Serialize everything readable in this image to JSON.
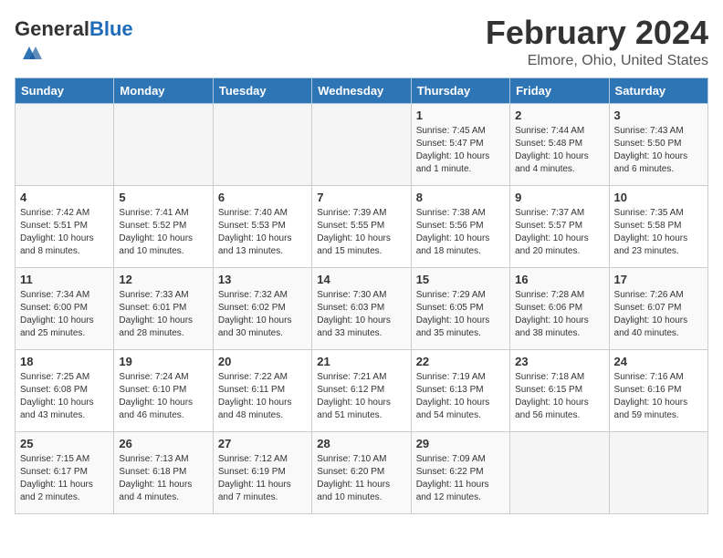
{
  "header": {
    "logo_general": "General",
    "logo_blue": "Blue",
    "month_title": "February 2024",
    "location": "Elmore, Ohio, United States"
  },
  "days_of_week": [
    "Sunday",
    "Monday",
    "Tuesday",
    "Wednesday",
    "Thursday",
    "Friday",
    "Saturday"
  ],
  "weeks": [
    [
      {
        "day": "",
        "info": ""
      },
      {
        "day": "",
        "info": ""
      },
      {
        "day": "",
        "info": ""
      },
      {
        "day": "",
        "info": ""
      },
      {
        "day": "1",
        "info": "Sunrise: 7:45 AM\nSunset: 5:47 PM\nDaylight: 10 hours\nand 1 minute."
      },
      {
        "day": "2",
        "info": "Sunrise: 7:44 AM\nSunset: 5:48 PM\nDaylight: 10 hours\nand 4 minutes."
      },
      {
        "day": "3",
        "info": "Sunrise: 7:43 AM\nSunset: 5:50 PM\nDaylight: 10 hours\nand 6 minutes."
      }
    ],
    [
      {
        "day": "4",
        "info": "Sunrise: 7:42 AM\nSunset: 5:51 PM\nDaylight: 10 hours\nand 8 minutes."
      },
      {
        "day": "5",
        "info": "Sunrise: 7:41 AM\nSunset: 5:52 PM\nDaylight: 10 hours\nand 10 minutes."
      },
      {
        "day": "6",
        "info": "Sunrise: 7:40 AM\nSunset: 5:53 PM\nDaylight: 10 hours\nand 13 minutes."
      },
      {
        "day": "7",
        "info": "Sunrise: 7:39 AM\nSunset: 5:55 PM\nDaylight: 10 hours\nand 15 minutes."
      },
      {
        "day": "8",
        "info": "Sunrise: 7:38 AM\nSunset: 5:56 PM\nDaylight: 10 hours\nand 18 minutes."
      },
      {
        "day": "9",
        "info": "Sunrise: 7:37 AM\nSunset: 5:57 PM\nDaylight: 10 hours\nand 20 minutes."
      },
      {
        "day": "10",
        "info": "Sunrise: 7:35 AM\nSunset: 5:58 PM\nDaylight: 10 hours\nand 23 minutes."
      }
    ],
    [
      {
        "day": "11",
        "info": "Sunrise: 7:34 AM\nSunset: 6:00 PM\nDaylight: 10 hours\nand 25 minutes."
      },
      {
        "day": "12",
        "info": "Sunrise: 7:33 AM\nSunset: 6:01 PM\nDaylight: 10 hours\nand 28 minutes."
      },
      {
        "day": "13",
        "info": "Sunrise: 7:32 AM\nSunset: 6:02 PM\nDaylight: 10 hours\nand 30 minutes."
      },
      {
        "day": "14",
        "info": "Sunrise: 7:30 AM\nSunset: 6:03 PM\nDaylight: 10 hours\nand 33 minutes."
      },
      {
        "day": "15",
        "info": "Sunrise: 7:29 AM\nSunset: 6:05 PM\nDaylight: 10 hours\nand 35 minutes."
      },
      {
        "day": "16",
        "info": "Sunrise: 7:28 AM\nSunset: 6:06 PM\nDaylight: 10 hours\nand 38 minutes."
      },
      {
        "day": "17",
        "info": "Sunrise: 7:26 AM\nSunset: 6:07 PM\nDaylight: 10 hours\nand 40 minutes."
      }
    ],
    [
      {
        "day": "18",
        "info": "Sunrise: 7:25 AM\nSunset: 6:08 PM\nDaylight: 10 hours\nand 43 minutes."
      },
      {
        "day": "19",
        "info": "Sunrise: 7:24 AM\nSunset: 6:10 PM\nDaylight: 10 hours\nand 46 minutes."
      },
      {
        "day": "20",
        "info": "Sunrise: 7:22 AM\nSunset: 6:11 PM\nDaylight: 10 hours\nand 48 minutes."
      },
      {
        "day": "21",
        "info": "Sunrise: 7:21 AM\nSunset: 6:12 PM\nDaylight: 10 hours\nand 51 minutes."
      },
      {
        "day": "22",
        "info": "Sunrise: 7:19 AM\nSunset: 6:13 PM\nDaylight: 10 hours\nand 54 minutes."
      },
      {
        "day": "23",
        "info": "Sunrise: 7:18 AM\nSunset: 6:15 PM\nDaylight: 10 hours\nand 56 minutes."
      },
      {
        "day": "24",
        "info": "Sunrise: 7:16 AM\nSunset: 6:16 PM\nDaylight: 10 hours\nand 59 minutes."
      }
    ],
    [
      {
        "day": "25",
        "info": "Sunrise: 7:15 AM\nSunset: 6:17 PM\nDaylight: 11 hours\nand 2 minutes."
      },
      {
        "day": "26",
        "info": "Sunrise: 7:13 AM\nSunset: 6:18 PM\nDaylight: 11 hours\nand 4 minutes."
      },
      {
        "day": "27",
        "info": "Sunrise: 7:12 AM\nSunset: 6:19 PM\nDaylight: 11 hours\nand 7 minutes."
      },
      {
        "day": "28",
        "info": "Sunrise: 7:10 AM\nSunset: 6:20 PM\nDaylight: 11 hours\nand 10 minutes."
      },
      {
        "day": "29",
        "info": "Sunrise: 7:09 AM\nSunset: 6:22 PM\nDaylight: 11 hours\nand 12 minutes."
      },
      {
        "day": "",
        "info": ""
      },
      {
        "day": "",
        "info": ""
      }
    ]
  ]
}
